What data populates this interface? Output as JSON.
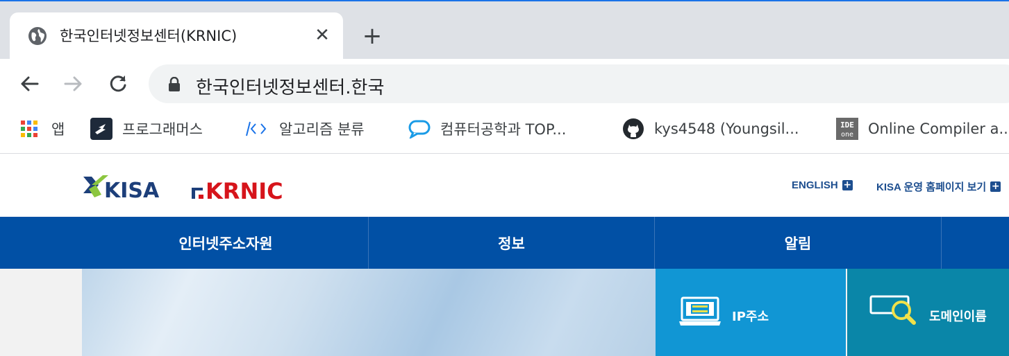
{
  "browser": {
    "tab": {
      "title": "한국인터넷정보센터(KRNIC)",
      "close_label": "✕"
    },
    "new_tab_label": "+",
    "address_bar": {
      "url": "한국인터넷정보센터.한국"
    },
    "bookmarks": [
      {
        "label": "앱",
        "icon": "apps-grid-icon"
      },
      {
        "label": "프로그래머스",
        "icon": "programmers-icon"
      },
      {
        "label": "알고리즘 분류",
        "icon": "code-brackets-icon"
      },
      {
        "label": "컴퓨터공학과 TOP...",
        "icon": "chat-bubble-icon"
      },
      {
        "label": "kys4548 (Youngsil...",
        "icon": "github-icon"
      },
      {
        "label": "Online Compiler a...",
        "icon": "ideone-icon"
      }
    ]
  },
  "site": {
    "header": {
      "logo_kisa_text": "KISA",
      "logo_krnic_text": "KRNIC",
      "links": [
        {
          "label": "ENGLISH",
          "plus": "+"
        },
        {
          "label": "KISA 운영 홈페이지 보기",
          "plus": "+"
        }
      ]
    },
    "gnb": [
      {
        "label": "인터넷주소자원"
      },
      {
        "label": "정보"
      },
      {
        "label": "알림"
      }
    ],
    "quick_menu": [
      {
        "label": "IP주소",
        "icon": "monitor-icon"
      },
      {
        "label": "도메인이름",
        "icon": "magnifier-icon"
      }
    ]
  },
  "colors": {
    "chrome_tabstrip": "#dee1e6",
    "gnb_blue": "#0150a5",
    "ip_box": "#1196d4",
    "domain_box": "#0a86a8",
    "krnic_red": "#d6141b",
    "kisa_navy": "#1d3f7a",
    "kisa_green": "#8cc63f"
  }
}
